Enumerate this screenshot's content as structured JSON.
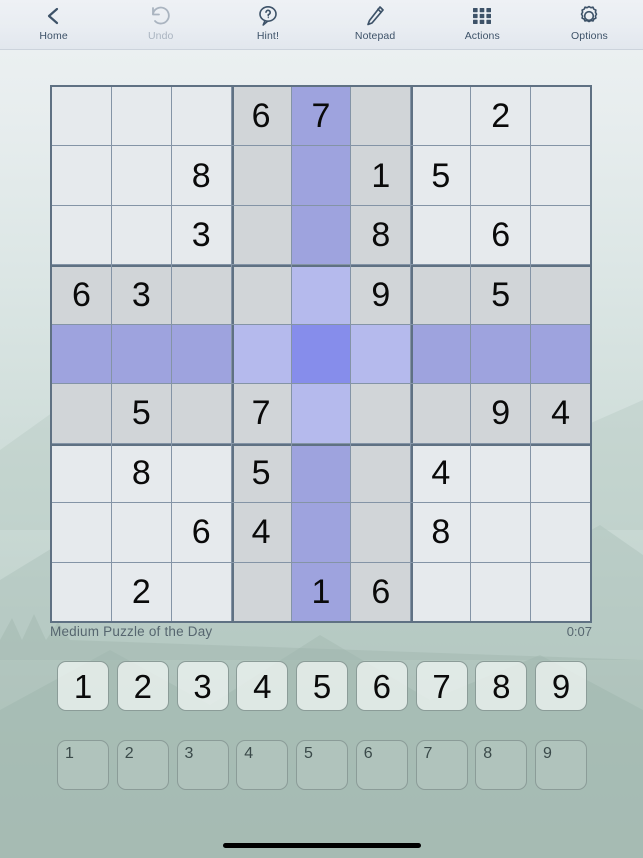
{
  "toolbar": {
    "items": [
      {
        "label": "Home",
        "icon": "chevron-left-icon",
        "disabled": false
      },
      {
        "label": "Undo",
        "icon": "undo-arrow-icon",
        "disabled": true
      },
      {
        "label": "Hint!",
        "icon": "question-bubble-icon",
        "disabled": false
      },
      {
        "label": "Notepad",
        "icon": "pencil-icon",
        "disabled": false
      },
      {
        "label": "Actions",
        "icon": "grid-dots-icon",
        "disabled": false
      },
      {
        "label": "Options",
        "icon": "gear-icon",
        "disabled": false
      }
    ]
  },
  "board": {
    "selected": {
      "row": 4,
      "col": 4
    },
    "rows": [
      [
        "",
        "",
        "",
        "6",
        "7",
        "",
        "",
        "2",
        ""
      ],
      [
        "",
        "",
        "8",
        "",
        "",
        "1",
        "5",
        "",
        ""
      ],
      [
        "",
        "",
        "3",
        "",
        "",
        "8",
        "",
        "6",
        ""
      ],
      [
        "6",
        "3",
        "",
        "",
        "",
        "9",
        "",
        "5",
        ""
      ],
      [
        "",
        "",
        "",
        "",
        "",
        "",
        "",
        "",
        ""
      ],
      [
        "",
        "5",
        "",
        "7",
        "",
        "",
        "",
        "9",
        "4"
      ],
      [
        "",
        "8",
        "",
        "5",
        "",
        "",
        "4",
        "",
        ""
      ],
      [
        "",
        "",
        "6",
        "4",
        "",
        "",
        "8",
        "",
        ""
      ],
      [
        "",
        "2",
        "",
        "",
        "1",
        "6",
        "",
        "",
        ""
      ]
    ],
    "title": "Medium Puzzle of the Day",
    "timer": "0:07"
  },
  "pad": {
    "main_keys": [
      "1",
      "2",
      "3",
      "4",
      "5",
      "6",
      "7",
      "8",
      "9"
    ],
    "note_keys": [
      "1",
      "2",
      "3",
      "4",
      "5",
      "6",
      "7",
      "8",
      "9"
    ]
  },
  "colors": {
    "selected_cell": "#868cee",
    "peer_cell": "#a2a5e6",
    "peer_light": "#babaf5",
    "box_highlight": "#d8dadc",
    "grid_line": "#5f7183",
    "toolbar_text": "#3d5268",
    "footer_text": "#56666f"
  }
}
